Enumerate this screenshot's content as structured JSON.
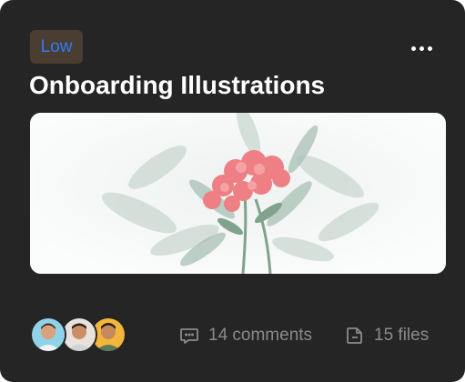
{
  "card": {
    "priority": "Low",
    "title": "Onboarding Illustrations",
    "image_icon": "flower-illustration",
    "comments_label": "14 comments",
    "files_label": "15 files",
    "members": [
      "avatar-1",
      "avatar-2",
      "avatar-3"
    ],
    "colors": {
      "background": "#252525",
      "badge_bg": "#4a3d31",
      "badge_text": "#2f7cf6",
      "meta_text": "#8a8a8a"
    }
  }
}
